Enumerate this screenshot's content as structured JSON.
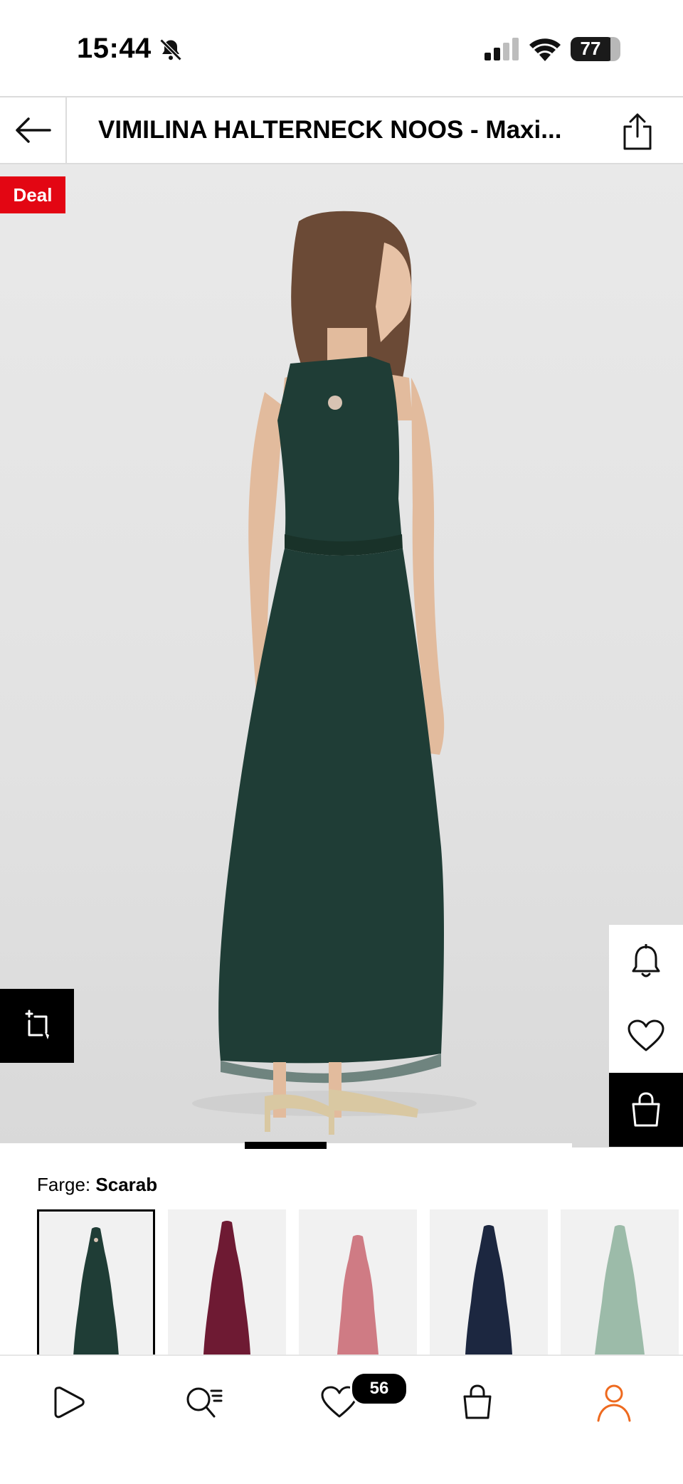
{
  "status_bar": {
    "time": "15:44",
    "battery": "77",
    "icons": [
      "bell-off-icon",
      "signal-icon",
      "wifi-icon",
      "battery-icon"
    ]
  },
  "header": {
    "title": "VIMILINA HALTERNECK NOOS - Maxi...",
    "back_icon": "arrow-left-icon",
    "share_icon": "share-icon"
  },
  "hero": {
    "badge": "Deal",
    "dress_color": "#1f3d36"
  },
  "product": {
    "color_label": "Farge:",
    "color_value": "Scarab",
    "swatches": [
      {
        "name": "Scarab",
        "color": "#1f3d36",
        "selected": true
      },
      {
        "name": "burgundy",
        "color": "#6e1a33",
        "selected": false
      },
      {
        "name": "rose",
        "color": "#cf7b84",
        "selected": false
      },
      {
        "name": "navy",
        "color": "#1c2740",
        "selected": false
      },
      {
        "name": "sage",
        "color": "#9cbba9",
        "selected": false
      }
    ]
  },
  "bottom_nav": {
    "items": [
      "home-icon",
      "search-icon",
      "wishlist-icon",
      "bag-icon",
      "profile-icon"
    ],
    "wishlist_count": "56",
    "active_color": "#ee6a1f"
  }
}
